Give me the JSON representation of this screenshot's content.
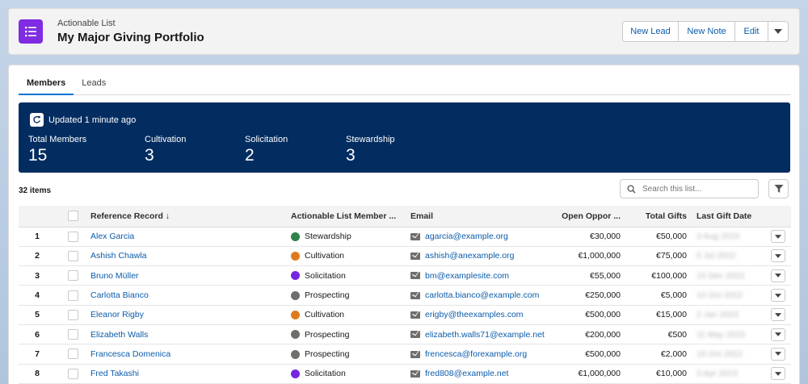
{
  "header": {
    "object_label": "Actionable List",
    "title": "My Major Giving Portfolio",
    "actions": [
      "New Lead",
      "New Note",
      "Edit"
    ]
  },
  "tabs": [
    {
      "label": "Members",
      "active": true
    },
    {
      "label": "Leads",
      "active": false
    }
  ],
  "summary": {
    "updated": "Updated 1 minute ago",
    "metrics": [
      {
        "label": "Total Members",
        "value": "15"
      },
      {
        "label": "Cultivation",
        "value": "3"
      },
      {
        "label": "Solicitation",
        "value": "2"
      },
      {
        "label": "Stewardship",
        "value": "3"
      }
    ]
  },
  "list": {
    "count": "32 items",
    "search_placeholder": "Search this list...",
    "columns": [
      "Reference Record ↓",
      "Actionable List Member ...",
      "Email",
      "Open Oppor ...",
      "Total Gifts",
      "Last Gift Date"
    ],
    "rows": [
      {
        "n": "1",
        "name": "Alex Garcia",
        "status": "Stewardship",
        "status_icon": "check-circle-icon",
        "email": "agarcia@example.org",
        "open": "€30,000",
        "total": "€50,000",
        "date": "3 Aug 2023"
      },
      {
        "n": "2",
        "name": "Ashish Chawla",
        "status": "Cultivation",
        "status_icon": "chat-icon",
        "email": "ashish@anexample.org",
        "open": "€1,000,000",
        "total": "€75,000",
        "date": "5 Jul 2022"
      },
      {
        "n": "3",
        "name": "Bruno Müller",
        "status": "Solicitation",
        "status_icon": "hand-icon",
        "email": "bm@examplesite.com",
        "open": "€55,000",
        "total": "€100,000",
        "date": "15 Dec 2022"
      },
      {
        "n": "4",
        "name": "Carlotta Bianco",
        "status": "Prospecting",
        "status_icon": "ellipsis-icon",
        "email": "carlotta.bianco@example.com",
        "open": "€250,000",
        "total": "€5,000",
        "date": "10 Oct 2022"
      },
      {
        "n": "5",
        "name": "Eleanor Rigby",
        "status": "Cultivation",
        "status_icon": "chat-icon",
        "email": "erigby@theexamples.com",
        "open": "€500,000",
        "total": "€15,000",
        "date": "2 Jan 2023"
      },
      {
        "n": "6",
        "name": "Elizabeth Walls",
        "status": "Prospecting",
        "status_icon": "ellipsis-icon",
        "email": "elizabeth.walls71@example.net",
        "open": "€200,000",
        "total": "€500",
        "date": "11 May 2023"
      },
      {
        "n": "7",
        "name": "Francesca Domenica",
        "status": "Prospecting",
        "status_icon": "ellipsis-icon",
        "email": "frencesca@forexample.org",
        "open": "€500,000",
        "total": "€2,000",
        "date": "18 Oct 2022"
      },
      {
        "n": "8",
        "name": "Fred Takashi",
        "status": "Solicitation",
        "status_icon": "hand-icon",
        "email": "fred808@example.net",
        "open": "€1,000,000",
        "total": "€10,000",
        "date": "3 Apr 2023"
      }
    ]
  },
  "colors": {
    "brand_purple": "#7f2ce2",
    "summary_bg": "#032d60",
    "link": "#0b5cab",
    "stewardship": "#2e844a",
    "cultivation": "#e07a1f",
    "solicitation": "#7526e3",
    "prospecting": "#706e6b"
  }
}
